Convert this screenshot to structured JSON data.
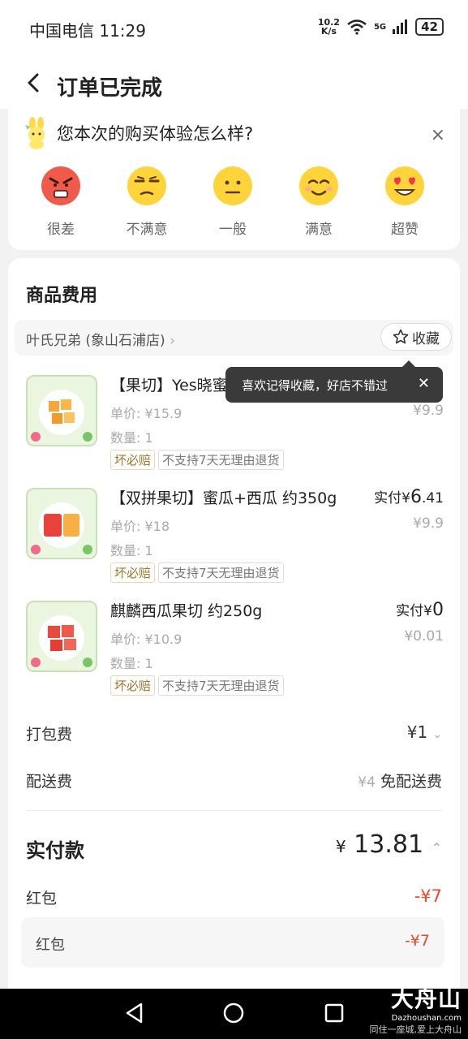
{
  "status_bar": {
    "carrier_time": "中国电信 11:29",
    "net_speed_value": "10.2",
    "net_speed_unit": "K/s",
    "network": "5G",
    "battery": "42"
  },
  "header": {
    "title": "订单已完成"
  },
  "rating": {
    "question": "您本次的购买体验怎么样?",
    "options": [
      {
        "label": "很差",
        "color": "#f05a4a"
      },
      {
        "label": "不满意",
        "color": "#ffd43b"
      },
      {
        "label": "一般",
        "color": "#ffd43b"
      },
      {
        "label": "满意",
        "color": "#ffd43b"
      },
      {
        "label": "超赞",
        "color": "#ffd43b"
      }
    ]
  },
  "costs": {
    "title": "商品费用",
    "store_name": "叶氏兄弟 (象山石浦店)",
    "favorite_label": "收藏",
    "tooltip": "喜欢记得收藏，好店不错过",
    "products": [
      {
        "name": "【果切】Yes晓蜜瓜",
        "unit_price": "单价: ¥15.9",
        "quantity": "数量: 1",
        "paid_prefix": "",
        "paid_value": "",
        "paid_tail": "",
        "original": "¥9.9",
        "tags": [
          "坏必赔",
          "不支持7天无理由退货"
        ]
      },
      {
        "name": "【双拼果切】蜜瓜+西瓜 约350g",
        "unit_price": "单价: ¥18",
        "quantity": "数量: 1",
        "paid_prefix": "实付¥",
        "paid_value": "6",
        "paid_tail": ".41",
        "original": "¥9.9",
        "tags": [
          "坏必赔",
          "不支持7天无理由退货"
        ]
      },
      {
        "name": "麒麟西瓜果切 约250g",
        "unit_price": "单价: ¥10.9",
        "quantity": "数量: 1",
        "paid_prefix": "实付¥",
        "paid_value": "0",
        "paid_tail": "",
        "original": "¥0.01",
        "tags": [
          "坏必赔",
          "不支持7天无理由退货"
        ]
      }
    ],
    "packing_fee_label": "打包费",
    "packing_fee_value": "¥1",
    "delivery_fee_label": "配送费",
    "delivery_fee_original": "¥4",
    "delivery_fee_value": "免配送费",
    "total_label": "实付款",
    "total_currency": "¥",
    "total_value": "13.81",
    "redpack_label": "红包",
    "redpack_value": "-¥7",
    "redpack_detail_label": "红包",
    "redpack_detail_value": "-¥7"
  },
  "watermark": {
    "brand": "大舟山",
    "site": "Dazhoushan.com",
    "slogan": "同住一座城,爱上大舟山"
  }
}
